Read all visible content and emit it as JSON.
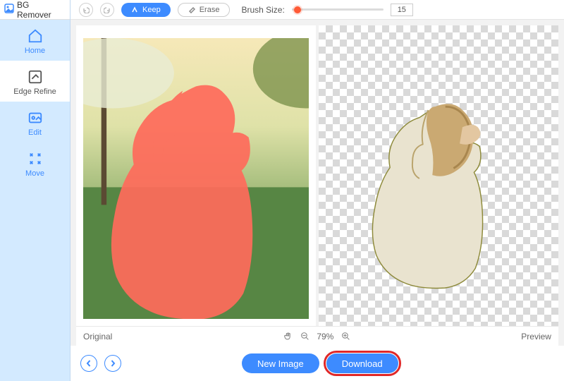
{
  "app_name": "BG Remover",
  "sidebar": {
    "items": [
      {
        "label": "Home",
        "icon": "home-icon"
      },
      {
        "label": "Edge Refine",
        "icon": "edge-refine-icon"
      },
      {
        "label": "Edit",
        "icon": "edit-icon"
      },
      {
        "label": "Move",
        "icon": "move-icon"
      }
    ],
    "active_index": 1
  },
  "toolbar": {
    "keep_label": "Keep",
    "erase_label": "Erase",
    "brush_label": "Brush Size:",
    "brush_value": "15"
  },
  "workspace": {
    "original_label": "Original",
    "preview_label": "Preview",
    "zoom_percent": "79%"
  },
  "footer": {
    "new_image_label": "New Image",
    "download_label": "Download"
  },
  "colors": {
    "accent": "#3d8bff",
    "mask": "#ff6b5b",
    "highlight_border": "#e02828"
  }
}
